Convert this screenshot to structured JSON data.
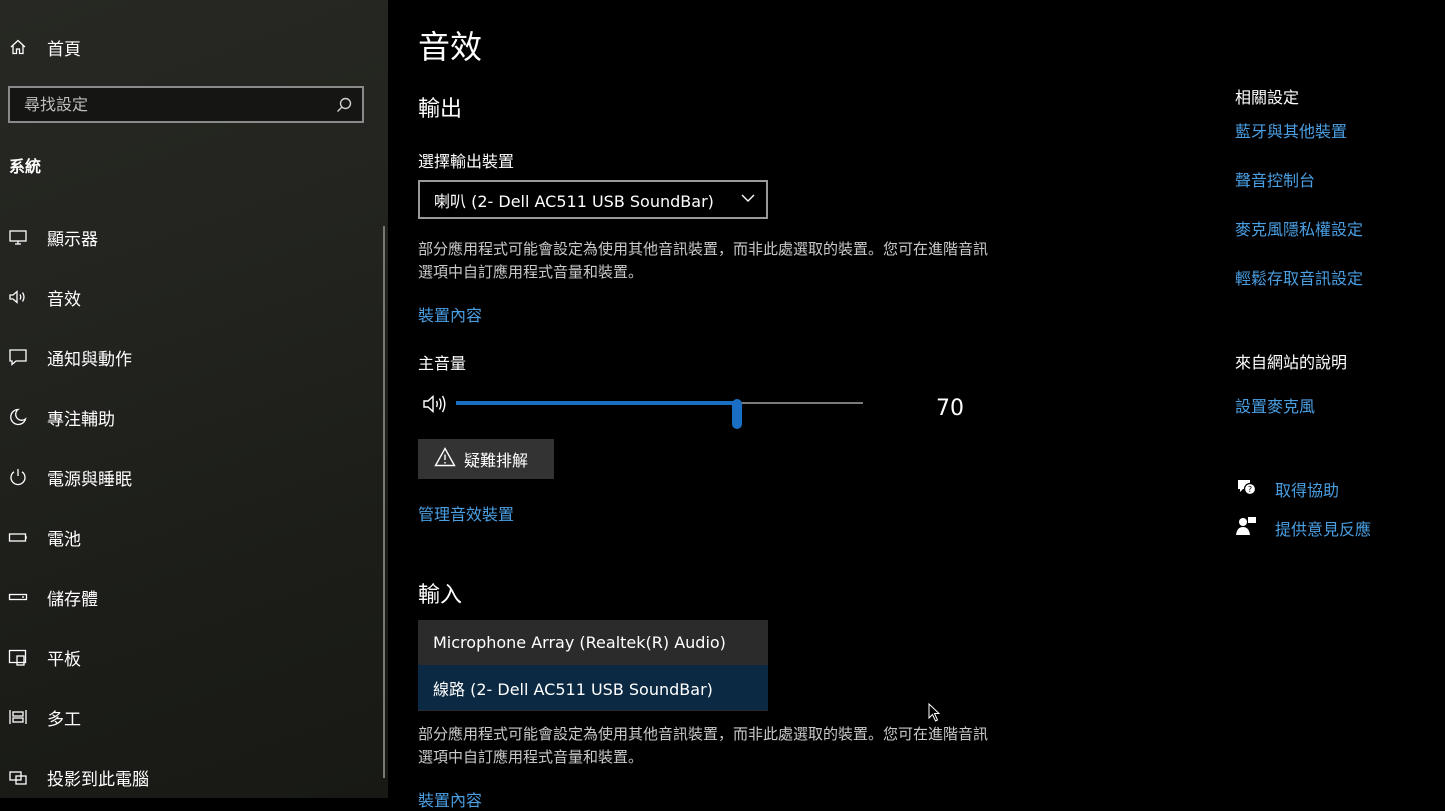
{
  "sidebar": {
    "home_label": "首頁",
    "search_placeholder": "尋找設定",
    "section_title": "系統",
    "items": [
      {
        "label": "顯示器",
        "icon": "monitor-icon"
      },
      {
        "label": "音效",
        "icon": "speaker-icon"
      },
      {
        "label": "通知與動作",
        "icon": "notification-icon"
      },
      {
        "label": "專注輔助",
        "icon": "moon-icon"
      },
      {
        "label": "電源與睡眠",
        "icon": "power-icon"
      },
      {
        "label": "電池",
        "icon": "battery-icon"
      },
      {
        "label": "儲存體",
        "icon": "storage-icon"
      },
      {
        "label": "平板",
        "icon": "tablet-icon"
      },
      {
        "label": "多工",
        "icon": "multitask-icon"
      },
      {
        "label": "投影到此電腦",
        "icon": "project-icon"
      }
    ]
  },
  "main": {
    "title": "音效",
    "output": {
      "heading": "輸出",
      "select_label": "選擇輸出裝置",
      "selected_device": "喇叭 (2- Dell AC511 USB SoundBar)",
      "note": "部分應用程式可能會設定為使用其他音訊裝置，而非此處選取的裝置。您可在進階音訊選項中自訂應用程式音量和裝置。",
      "properties_link": "裝置內容",
      "volume_label": "主音量",
      "volume_value": "70",
      "volume_fraction": 0.69,
      "troubleshoot_label": "疑難排解",
      "manage_link": "管理音效裝置"
    },
    "input": {
      "heading": "輸入",
      "options": [
        "Microphone Array (Realtek(R) Audio)",
        "線路 (2- Dell AC511 USB SoundBar)"
      ],
      "selected_index": 1,
      "note": "部分應用程式可能會設定為使用其他音訊裝置，而非此處選取的裝置。您可在進階音訊選項中自訂應用程式音量和裝置。",
      "properties_link": "裝置內容"
    }
  },
  "right": {
    "related_heading": "相關設定",
    "related_links": [
      "藍牙與其他裝置",
      "聲音控制台",
      "麥克風隱私權設定",
      "輕鬆存取音訊設定"
    ],
    "web_heading": "來自網站的說明",
    "web_links": [
      "設置麥克風"
    ],
    "get_help": "取得協助",
    "feedback": "提供意見反應"
  },
  "colors": {
    "accent": "#4a9ee2",
    "slider": "#1a6fc4",
    "sidebar_bg": "#23241f"
  }
}
